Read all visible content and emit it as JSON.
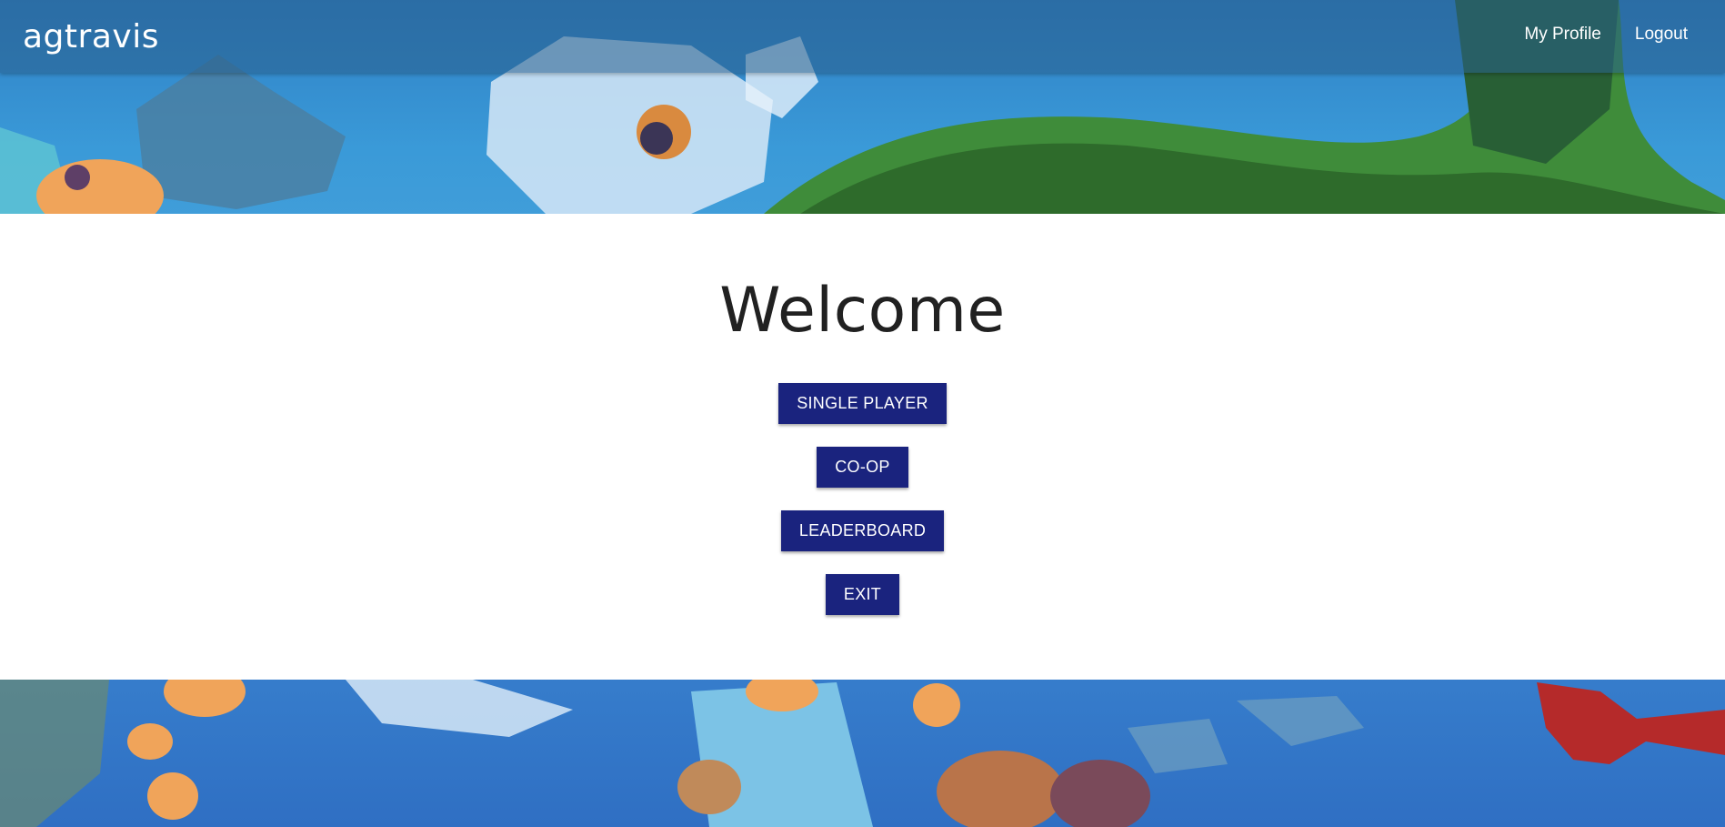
{
  "navbar": {
    "brand": "agtravis",
    "links": [
      {
        "label": "My Profile"
      },
      {
        "label": "Logout"
      }
    ]
  },
  "main": {
    "heading": "Welcome",
    "buttons": [
      {
        "label": "SINGLE PLAYER"
      },
      {
        "label": "CO-OP"
      },
      {
        "label": "LEADERBOARD"
      },
      {
        "label": "EXIT"
      }
    ]
  },
  "colors": {
    "button_bg": "#1a237e",
    "button_text": "#ffffff",
    "heading_text": "#212121",
    "nav_text": "#ffffff"
  }
}
